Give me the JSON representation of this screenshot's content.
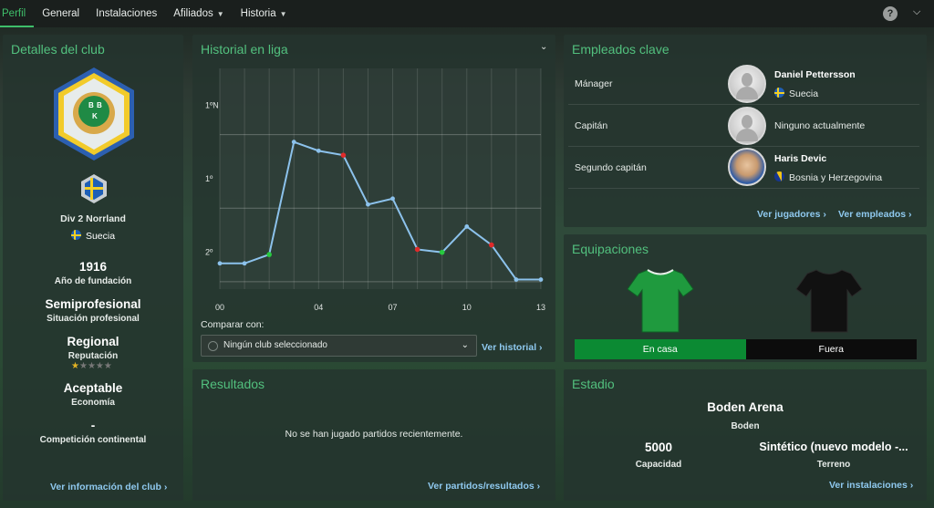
{
  "tabs": [
    {
      "label": "Perfil"
    },
    {
      "label": "General"
    },
    {
      "label": "Instalaciones"
    },
    {
      "label": "Afiliados"
    },
    {
      "label": "Historia"
    }
  ],
  "help_label": "?",
  "club_details": {
    "title": "Detalles del club",
    "division": "Div 2 Norrland",
    "country": "Suecia",
    "founded": "1916",
    "founded_label": "Año de fundación",
    "status": "Semiprofesional",
    "status_label": "Situación profesional",
    "reputation": "Regional",
    "reputation_label": "Reputación",
    "reputation_stars": 1,
    "reputation_max": 5,
    "economy": "Aceptable",
    "economy_label": "Economía",
    "continental": "-",
    "continental_label": "Competición continental",
    "link": "Ver información del club"
  },
  "league_history": {
    "title": "Historial en liga",
    "compare_label": "Comparar con:",
    "compare_value": "Ningún club seleccionado",
    "link": "Ver historial"
  },
  "chart_data": {
    "type": "line",
    "title": "",
    "xlabel": "",
    "ylabel": "",
    "x_tick_labels": [
      "00",
      "04",
      "07",
      "10",
      "13"
    ],
    "y_tick_labels": [
      "1ºN",
      "1º",
      "2º"
    ],
    "x": [
      0,
      1,
      2,
      3,
      4,
      5,
      6,
      7,
      8,
      9,
      10,
      11,
      12,
      13
    ],
    "series": [
      {
        "values": [
          2.75,
          2.75,
          2.63,
          1.1,
          1.22,
          1.28,
          1.95,
          1.87,
          2.56,
          2.6,
          2.25,
          2.5,
          2.97,
          2.97
        ]
      }
    ],
    "marker_colors": [
      "none",
      "none",
      "#27c93f",
      "none",
      "none",
      "#e02a2a",
      "none",
      "none",
      "#e02a2a",
      "#27c93f",
      "none",
      "#e02a2a",
      "none",
      "none"
    ],
    "line_color": "#8cc2ec",
    "grid": true
  },
  "results": {
    "title": "Resultados",
    "empty_text": "No se han jugado partidos recientemente.",
    "link": "Ver partidos/resultados"
  },
  "key_staff": {
    "title": "Empleados clave",
    "rows": [
      {
        "role": "Mánager",
        "name": "Daniel Pettersson",
        "nation": "Suecia"
      },
      {
        "role": "Capitán",
        "name": "Ninguno actualmente"
      },
      {
        "role": "Segundo capitán",
        "name": "Haris Devic",
        "nation": "Bosnia y Herzegovina"
      }
    ],
    "link_players": "Ver jugadores",
    "link_staff": "Ver empleados"
  },
  "kits": {
    "title": "Equipaciones",
    "home_label": "En casa",
    "away_label": "Fuera",
    "home_color": "#1f9a3e",
    "away_color": "#111111"
  },
  "stadium": {
    "title": "Estadio",
    "name": "Boden Arena",
    "city": "Boden",
    "capacity": "5000",
    "capacity_label": "Capacidad",
    "surface": "Sintético (nuevo modelo -...",
    "surface_label": "Terreno",
    "link": "Ver instalaciones"
  }
}
